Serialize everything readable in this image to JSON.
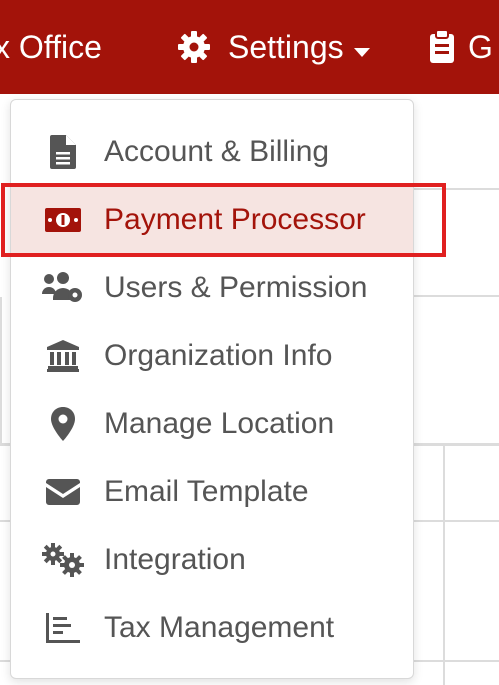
{
  "navbar": {
    "box_office_label": "x Office",
    "settings_label": "Settings",
    "third_item_label": "G"
  },
  "menu": {
    "items": [
      {
        "label": "Account & Billing",
        "icon": "file-icon"
      },
      {
        "label": "Payment Processor",
        "icon": "money-bill-icon",
        "active": true
      },
      {
        "label": "Users & Permission",
        "icon": "users-cog-icon"
      },
      {
        "label": "Organization Info",
        "icon": "bank-icon"
      },
      {
        "label": "Manage Location",
        "icon": "map-marker-icon"
      },
      {
        "label": "Email Template",
        "icon": "envelope-icon"
      },
      {
        "label": "Integration",
        "icon": "cogs-icon"
      },
      {
        "label": "Tax Management",
        "icon": "chart-bars-icon"
      }
    ]
  },
  "colors": {
    "navbar_bg": "#a3130a",
    "active_text": "#a3130a",
    "active_bg": "#f6e4e1",
    "highlight_border": "#e02020",
    "icon_color": "#555555"
  }
}
